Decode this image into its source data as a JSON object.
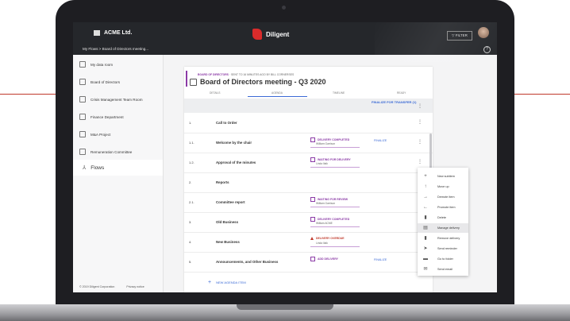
{
  "app": {
    "company": "ACME Ltd.",
    "brand": "Diligent",
    "filter": "FILTER",
    "breadcrumb": "My Flows  >  Board of Directors meeting..."
  },
  "sidebar": {
    "items": [
      "My data room",
      "Board of Directors",
      "Crisis Management Team Room",
      "Finance Department",
      "M&A Project",
      "Remuneration Committee"
    ],
    "active": "Flows",
    "footer": {
      "copyright": "© 2019 Diligent Corporation",
      "privacy": "Privacy notice"
    }
  },
  "meeting": {
    "subtitle_strong": "BOARD OF DIRECTORS",
    "subtitle_rest": " · SENT TO 16 MINUTES AGO BY BILL CORNERSES",
    "title": "Board of Directors meeting - Q3 2020",
    "tabs": [
      "DETAILS",
      "AGENDA",
      "TIMELINE",
      "READY"
    ],
    "header_action": "FINALIZE FOR TRANSFER (1)"
  },
  "agenda": [
    {
      "num": "1.",
      "title": "Call to Order",
      "status": "",
      "who": "",
      "finalize": ""
    },
    {
      "num": "1.1.",
      "title": "Welcome by the chair",
      "status": "DELIVERY COMPLETED",
      "who": "William Garrison",
      "finalize": "FINALIZE"
    },
    {
      "num": "1.2.",
      "title": "Approval of the minutes",
      "status": "WAITING FOR DELIVERY",
      "who": "Linda Ilaik",
      "finalize": ""
    },
    {
      "num": "2.",
      "title": "Reports",
      "status": "",
      "who": "",
      "finalize": ""
    },
    {
      "num": "2.1.",
      "title": "Committee report",
      "status": "WAITING FOR REVIEW",
      "who": "William Garrison",
      "finalize": ""
    },
    {
      "num": "3.",
      "title": "Old Business",
      "status": "DELIVERY COMPLETED",
      "who": "William ACME",
      "finalize": ""
    },
    {
      "num": "4.",
      "title": "New Business",
      "status": "DELIVERY OVERDUE",
      "who": "Linda Ilaik",
      "finalize": ""
    },
    {
      "num": "5.",
      "title": "Announcements, and Other Business",
      "status": "ADD DELIVERY",
      "who": "",
      "finalize": "FINALIZE"
    }
  ],
  "add_item": "NEW AGENDA ITEM",
  "context_menu": [
    {
      "label": "New subitem",
      "icon": "plus-icon"
    },
    {
      "label": "Move up",
      "icon": "arrow-up-icon"
    },
    {
      "label": "Demote item",
      "icon": "arrow-right-icon"
    },
    {
      "label": "Promote item",
      "icon": "arrow-left-icon"
    },
    {
      "label": "Delete",
      "icon": "trash-icon"
    },
    {
      "label": "Manage delivery",
      "icon": "document-icon"
    },
    {
      "label": "Remove delivery",
      "icon": "trash-icon"
    },
    {
      "label": "Send reminder",
      "icon": "send-icon"
    },
    {
      "label": "Go to folder",
      "icon": "folder-icon"
    },
    {
      "label": "Send email",
      "icon": "mail-icon"
    }
  ],
  "colors": {
    "accent": "#8b3aa6",
    "link": "#3b6ad6",
    "brand": "#d92b2b",
    "overdue": "#c0392b"
  }
}
